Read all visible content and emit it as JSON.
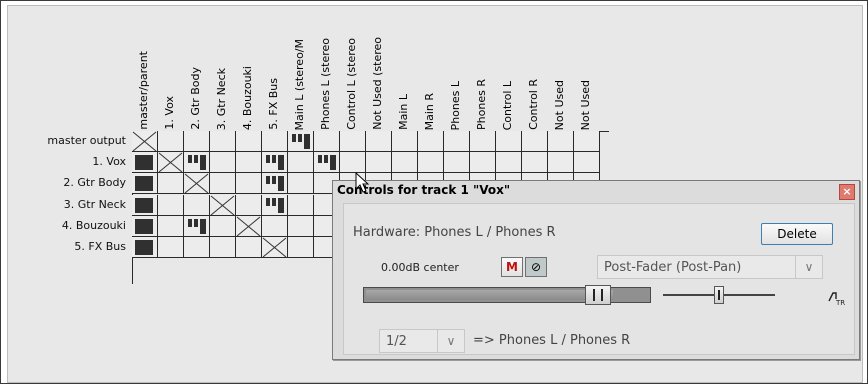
{
  "routing": {
    "columns": [
      "master/parent",
      "1. Vox",
      "2. Gtr Body",
      "3. Gtr Neck",
      "4. Bouzouki",
      "5. FX Bus",
      "Main L (stereo/M",
      "Phones L (stereo",
      "Control L (stereo",
      "Not Used (stereo",
      "Main L",
      "Main R",
      "Phones L",
      "Phones R",
      "Control L",
      "Control R",
      "Not Used",
      "Not Used"
    ],
    "rows": [
      "master output",
      "1. Vox",
      "2. Gtr Body",
      "3. Gtr Neck",
      "4. Bouzouki",
      "5. FX Bus"
    ],
    "cells": {
      "cross": [
        [
          0,
          0
        ],
        [
          1,
          1
        ],
        [
          2,
          2
        ],
        [
          3,
          3
        ],
        [
          4,
          4
        ],
        [
          5,
          5
        ]
      ],
      "solid": [
        [
          1,
          0
        ],
        [
          2,
          0
        ],
        [
          3,
          0
        ],
        [
          4,
          0
        ],
        [
          5,
          0
        ]
      ],
      "stereo": [
        [
          0,
          6
        ],
        [
          1,
          2
        ],
        [
          1,
          5
        ],
        [
          1,
          7
        ],
        [
          2,
          5
        ],
        [
          3,
          5
        ],
        [
          4,
          2
        ]
      ]
    }
  },
  "dialog": {
    "title": "Controls for track 1 \"Vox\"",
    "close_glyph": "×",
    "hardware_label": "Hardware: Phones L / Phones R",
    "delete_label": "Delete",
    "volume_text": "0.00dB center",
    "mute_label": "M",
    "phase_glyph": "⊘",
    "mode_value": "Post-Fader (Post-Pan)",
    "dropdown_glyph": "∨",
    "volume_level": 0.87,
    "pan_level": 0.5,
    "channel_value": "1/2",
    "dest_text": "=> Phones L / Phones R",
    "env_icon_label": "TR"
  }
}
